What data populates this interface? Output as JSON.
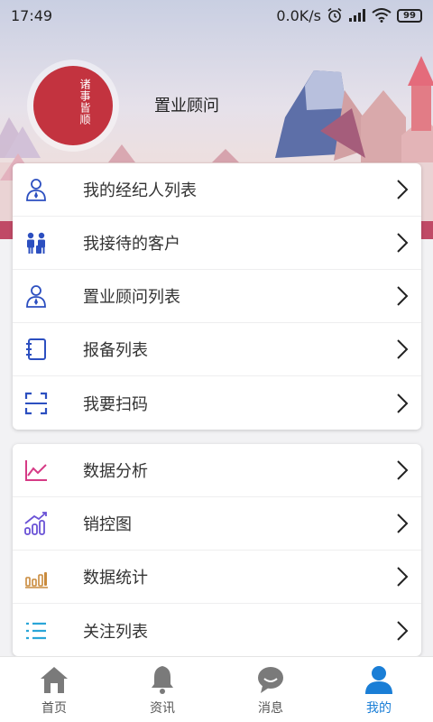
{
  "status_bar": {
    "time": "17:49",
    "network_speed": "0.0K/s",
    "battery": "99"
  },
  "profile": {
    "avatar_text": "诸事皆顺",
    "role": "置业顾问"
  },
  "menu_group_1": [
    {
      "label": "我的经纪人列表",
      "icon": "agent-person-icon"
    },
    {
      "label": "我接待的客户",
      "icon": "customers-icon"
    },
    {
      "label": "置业顾问列表",
      "icon": "consultant-person-icon"
    },
    {
      "label": "报备列表",
      "icon": "notebook-icon"
    },
    {
      "label": "我要扫码",
      "icon": "scan-icon"
    }
  ],
  "menu_group_2": [
    {
      "label": "数据分析",
      "icon": "line-chart-icon"
    },
    {
      "label": "销控图",
      "icon": "trend-bars-icon"
    },
    {
      "label": "数据统计",
      "icon": "bar-stats-icon"
    },
    {
      "label": "关注列表",
      "icon": "list-icon"
    }
  ],
  "tabbar": [
    {
      "label": "首页",
      "icon": "home-icon"
    },
    {
      "label": "资讯",
      "icon": "bell-icon"
    },
    {
      "label": "消息",
      "icon": "chat-bubble-icon"
    },
    {
      "label": "我的",
      "icon": "user-icon",
      "active": true
    }
  ],
  "colors": {
    "accent_blue": "#1a7ed6",
    "icon_blue": "#2c4fc0",
    "chart_pink": "#d63b86",
    "chart_purple": "#6a52d6",
    "stats_orange": "#c98a3c",
    "list_cyan": "#2aa6d8",
    "avatar_red": "#c3333f"
  }
}
